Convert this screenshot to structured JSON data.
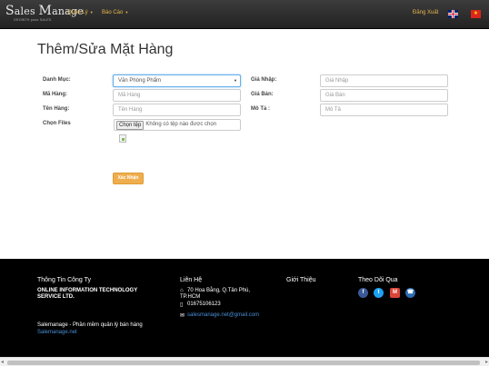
{
  "navbar": {
    "brand_main_s": "S",
    "brand_main_ales": "ales",
    "brand_main_m": "M",
    "brand_main_anage": "anage",
    "brand_tagline": "GROWTH pass SALES",
    "menu": [
      {
        "label": "Quản Lý"
      },
      {
        "label": "Báo Cáo"
      }
    ],
    "logout_label": "Đăng Xuất",
    "lang_flags": [
      "uk-flag-icon",
      "vn-flag-icon"
    ],
    "vn_star": "★"
  },
  "page": {
    "title": "Thêm/Sửa Mặt Hàng"
  },
  "form": {
    "category_label": "Danh Mục:",
    "category_value": "Văn Phòng Phẩm",
    "code_label": "Mã Hàng:",
    "code_placeholder": "Mã Hàng",
    "name_label": "Tên Hàng:",
    "name_placeholder": "Tên Hàng",
    "files_label": "Chọn Files",
    "file_button": "Chọn tệp",
    "file_status": "Không có tệp nào được chọn",
    "cost_label": "Giá Nhập:",
    "cost_placeholder": "Giá Nhập",
    "price_label": "Giá Bán:",
    "price_placeholder": "Giá Bán",
    "desc_label": "Mô Tả :",
    "desc_placeholder": "Mô Tả",
    "submit_label": "Xác Nhận"
  },
  "footer": {
    "company_heading": "Thông Tin Công Ty",
    "company_name_line1": "ONLINE INFORMATION TECHNOLOGY",
    "company_name_line2": "SERVICE LTD.",
    "product_text": "Salemanage - Phần mềm quản lý bán hàng",
    "product_link": "Salemanage.net",
    "contact_heading": "Liên Hệ",
    "address_line1": "70 Hoa Bằng, Q.Tân Phú,",
    "address_line2": "TP.HCM",
    "phone": "01675106123",
    "email": "salesmanage.net@gmail.com",
    "intro_heading": "Giới Thiệu",
    "follow_heading": "Theo Dõi Qua",
    "social": [
      "facebook-icon",
      "twitter-icon",
      "gmail-icon",
      "phone-icon"
    ]
  },
  "colors": {
    "accent": "#efae4e",
    "nav_text": "#e8b64a",
    "footer_bg": "#000000",
    "link": "#4a90d9"
  }
}
